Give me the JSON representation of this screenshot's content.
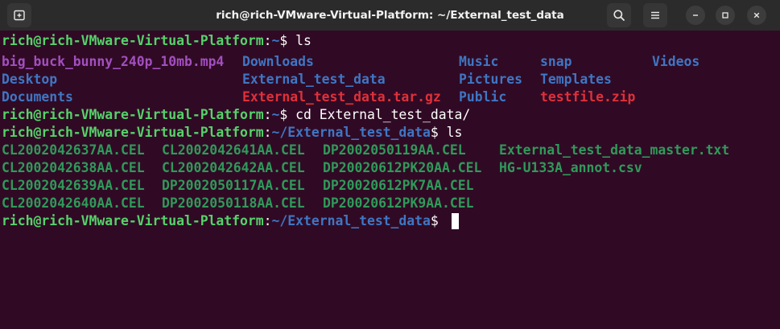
{
  "window": {
    "title": "rich@rich-VMware-Virtual-Platform: ~/External_test_data"
  },
  "titlebar_icons": {
    "new_tab": "new-tab-icon",
    "search": "search-icon",
    "menu": "hamburger-menu-icon",
    "minimize": "minimize-icon",
    "maximize": "maximize-icon",
    "close": "close-icon"
  },
  "colors": {
    "background": "#300a24",
    "user_host": "#55d26a",
    "path": "#3f76c4",
    "video_file": "#a24fc0",
    "directory": "#3f76c4",
    "archive": "#e0303a",
    "data_file": "#2f9a5a"
  },
  "terminal": {
    "prompt1": {
      "user_host": "rich@rich-VMware-Virtual-Platform",
      "sep": ":",
      "path": "~",
      "symbol": "$",
      "command": " ls"
    },
    "ls1": {
      "row1": [
        "big_buck_bunny_240p_10mb.mp4",
        "Downloads",
        "Music",
        "snap",
        "Videos"
      ],
      "row2": [
        "Desktop",
        "External_test_data",
        "Pictures",
        "Templates"
      ],
      "row3": [
        "Documents",
        "External_test_data.tar.gz",
        "Public",
        "testfile.zip"
      ]
    },
    "prompt2": {
      "user_host": "rich@rich-VMware-Virtual-Platform",
      "sep": ":",
      "path": "~",
      "symbol": "$",
      "command": " cd External_test_data/"
    },
    "prompt3": {
      "user_host": "rich@rich-VMware-Virtual-Platform",
      "sep": ":",
      "path": "~/External_test_data",
      "symbol": "$",
      "command": " ls"
    },
    "ls2": {
      "row1": [
        "CL2002042637AA.CEL",
        "CL2002042641AA.CEL",
        "DP2002050119AA.CEL",
        "External_test_data_master.txt"
      ],
      "row2": [
        "CL2002042638AA.CEL",
        "CL2002042642AA.CEL",
        "DP20020612PK20AA.CEL",
        "HG-U133A_annot.csv"
      ],
      "row3": [
        "CL2002042639AA.CEL",
        "DP2002050117AA.CEL",
        "DP20020612PK7AA.CEL"
      ],
      "row4": [
        "CL2002042640AA.CEL",
        "DP2002050118AA.CEL",
        "DP20020612PK9AA.CEL"
      ]
    },
    "prompt4": {
      "user_host": "rich@rich-VMware-Virtual-Platform",
      "sep": ":",
      "path": "~/External_test_data",
      "symbol": "$",
      "command": " "
    }
  }
}
